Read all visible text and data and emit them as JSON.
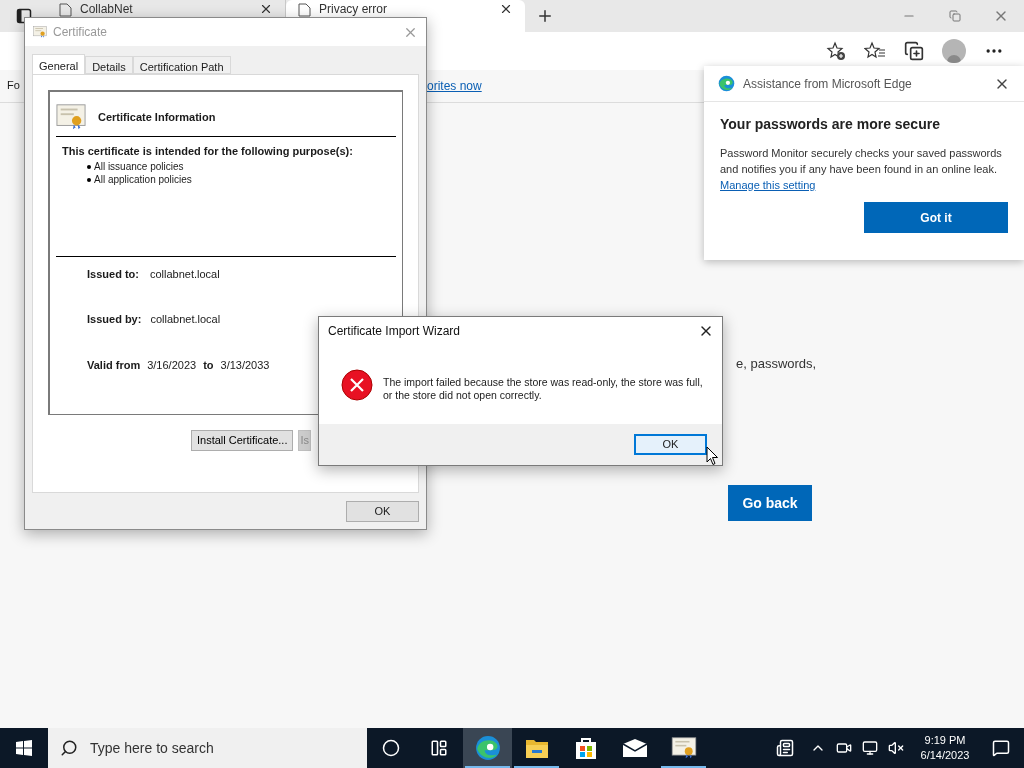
{
  "browser": {
    "tabs": [
      {
        "title": "CollabNet",
        "selected": false
      },
      {
        "title": "Privacy error",
        "selected": true
      }
    ],
    "favorites_bar_text": "Fo",
    "favorites_link": "orites now"
  },
  "page": {
    "text_fragment": "e, passwords,",
    "go_back": "Go back"
  },
  "edge_popup": {
    "header": "Assistance from Microsoft Edge",
    "title": "Your passwords are more secure",
    "body": "Password Monitor securely checks your saved passwords and notifies you if any have been found in an online leak.",
    "link": "Manage this setting",
    "button": "Got it"
  },
  "certificate_dialog": {
    "title": "Certificate",
    "tabs": [
      {
        "label": "General",
        "selected": true
      },
      {
        "label": "Details",
        "selected": false
      },
      {
        "label": "Certification Path",
        "selected": false
      }
    ],
    "info_title": "Certificate Information",
    "purpose_heading": "This certificate is intended for the following purpose(s):",
    "purposes": [
      "All issuance policies",
      "All application policies"
    ],
    "issued_to_label": "Issued to:",
    "issued_to": "collabnet.local",
    "issued_by_label": "Issued by:",
    "issued_by": "collabnet.local",
    "valid_from_label": "Valid from",
    "valid_from": "3/16/2023",
    "to_label": "to",
    "valid_to": "3/13/2033",
    "buttons": [
      {
        "label": "Install Certificate...",
        "disabled": false
      },
      {
        "label": "Is",
        "disabled": true
      }
    ],
    "ok": "OK"
  },
  "wizard_dialog": {
    "title": "Certificate Import Wizard",
    "message": "The import failed because the store was read-only, the store was full, or the store did not open correctly.",
    "ok": "OK"
  },
  "taskbar": {
    "search_placeholder": "Type here to search",
    "apps": [
      {
        "kind": "edge",
        "selected": true,
        "running": true
      },
      {
        "kind": "explorer",
        "selected": false,
        "running": true
      },
      {
        "kind": "store",
        "selected": false,
        "running": false
      },
      {
        "kind": "mail",
        "selected": false,
        "running": false
      },
      {
        "kind": "certificate",
        "selected": false,
        "running": true
      }
    ],
    "time": "9:19 PM",
    "date": "6/14/2023"
  }
}
